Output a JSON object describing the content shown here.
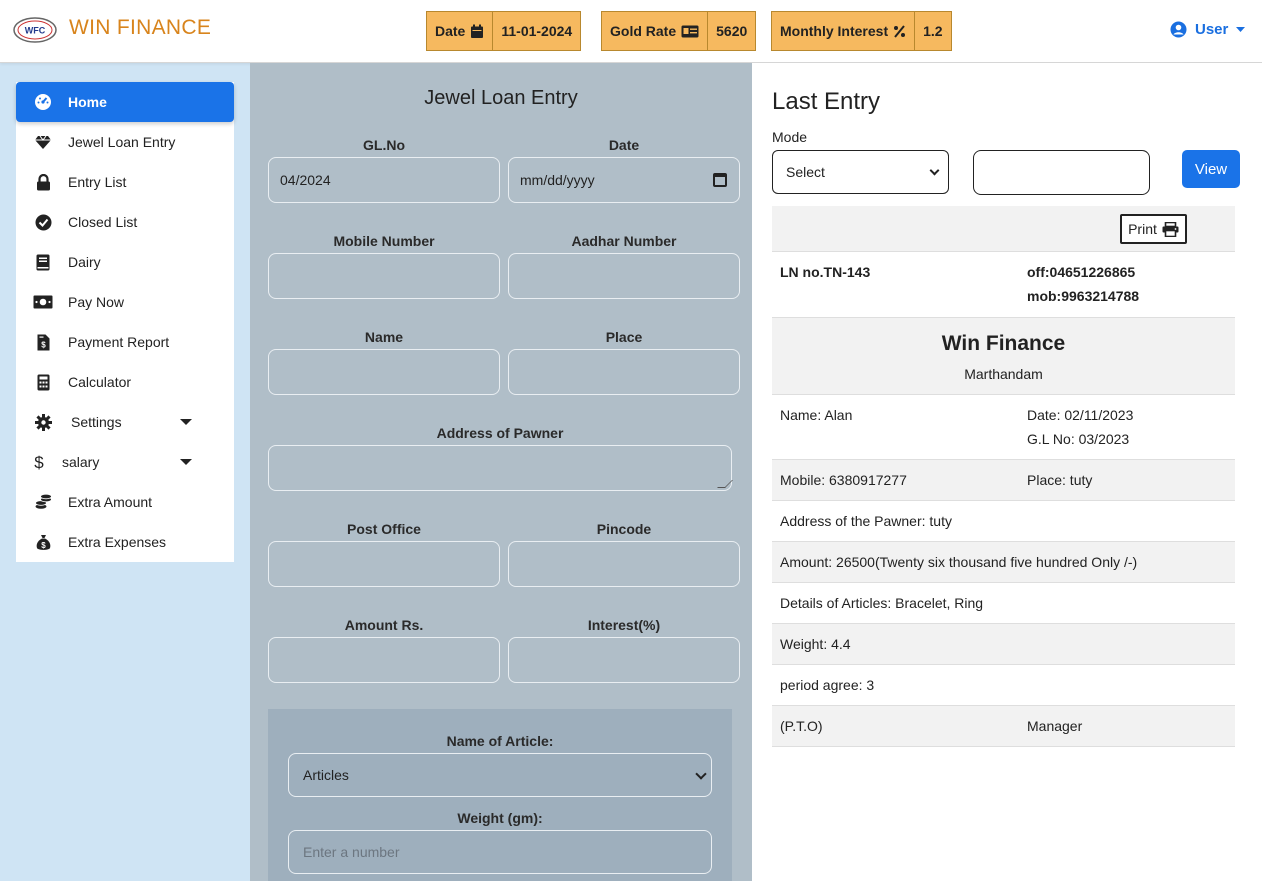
{
  "header": {
    "brand": "WIN FINANCE",
    "logo_text": "WFC",
    "date_label": "Date",
    "date_value": "11-01-2024",
    "gold_label": "Gold Rate",
    "gold_value": "5620",
    "interest_label": "Monthly Interest",
    "interest_value": "1.2",
    "user_label": "User"
  },
  "sidebar": {
    "items": [
      {
        "label": "Home",
        "icon": "gauge-icon"
      },
      {
        "label": "Jewel Loan Entry",
        "icon": "gem-icon"
      },
      {
        "label": "Entry List",
        "icon": "lock-icon"
      },
      {
        "label": "Closed List",
        "icon": "check-circle-icon"
      },
      {
        "label": "Dairy",
        "icon": "book-icon"
      },
      {
        "label": "Pay Now",
        "icon": "money-icon"
      },
      {
        "label": "Payment Report",
        "icon": "invoice-icon"
      },
      {
        "label": "Calculator",
        "icon": "calculator-icon"
      },
      {
        "label": "Settings",
        "icon": "gear-icon"
      },
      {
        "label": "salary",
        "icon": "dollar-icon"
      },
      {
        "label": "Extra Amount",
        "icon": "coins-icon"
      },
      {
        "label": "Extra Expenses",
        "icon": "money-bag-icon"
      }
    ]
  },
  "form": {
    "title": "Jewel Loan Entry",
    "glno_label": "GL.No",
    "glno_value": "04/2024",
    "date_label": "Date",
    "date_placeholder": "mm/dd/yyyy",
    "mobile_label": "Mobile Number",
    "aadhar_label": "Aadhar Number",
    "name_label": "Name",
    "place_label": "Place",
    "address_label": "Address of Pawner",
    "post_label": "Post Office",
    "pincode_label": "Pincode",
    "amount_label": "Amount Rs.",
    "interest_label": "Interest(%)",
    "article_label": "Name of Article:",
    "article_value": "Articles",
    "weight_label": "Weight (gm):",
    "weight_placeholder": "Enter a number"
  },
  "last_entry": {
    "title": "Last Entry",
    "mode_label": "Mode",
    "mode_value": "Select",
    "view_label": "View",
    "print_label": "Print",
    "ln_no": "LN no.TN-143",
    "office": "off:04651226865",
    "mobile_office": "mob:9963214788",
    "company": "Win Finance",
    "branch": "Marthandam",
    "name": "Name: Alan",
    "date": "Date: 02/11/2023",
    "gl_no": "G.L No: 03/2023",
    "mobile": "Mobile: 6380917277",
    "place": "Place: tuty",
    "address": "Address of the Pawner: tuty",
    "amount": "Amount: 26500(Twenty six thousand five hundred Only /-)",
    "articles": "Details of Articles: Bracelet, Ring",
    "weight": "Weight: 4.4",
    "period": "period agree: 3",
    "pto": "(P.T.O)",
    "manager": "Manager"
  },
  "colors": {
    "accent": "#1a73e8",
    "brand": "#d8841c",
    "chip": "#f6b95f",
    "form_bg": "#b0bec8",
    "page_bg": "#cfe4f4"
  }
}
